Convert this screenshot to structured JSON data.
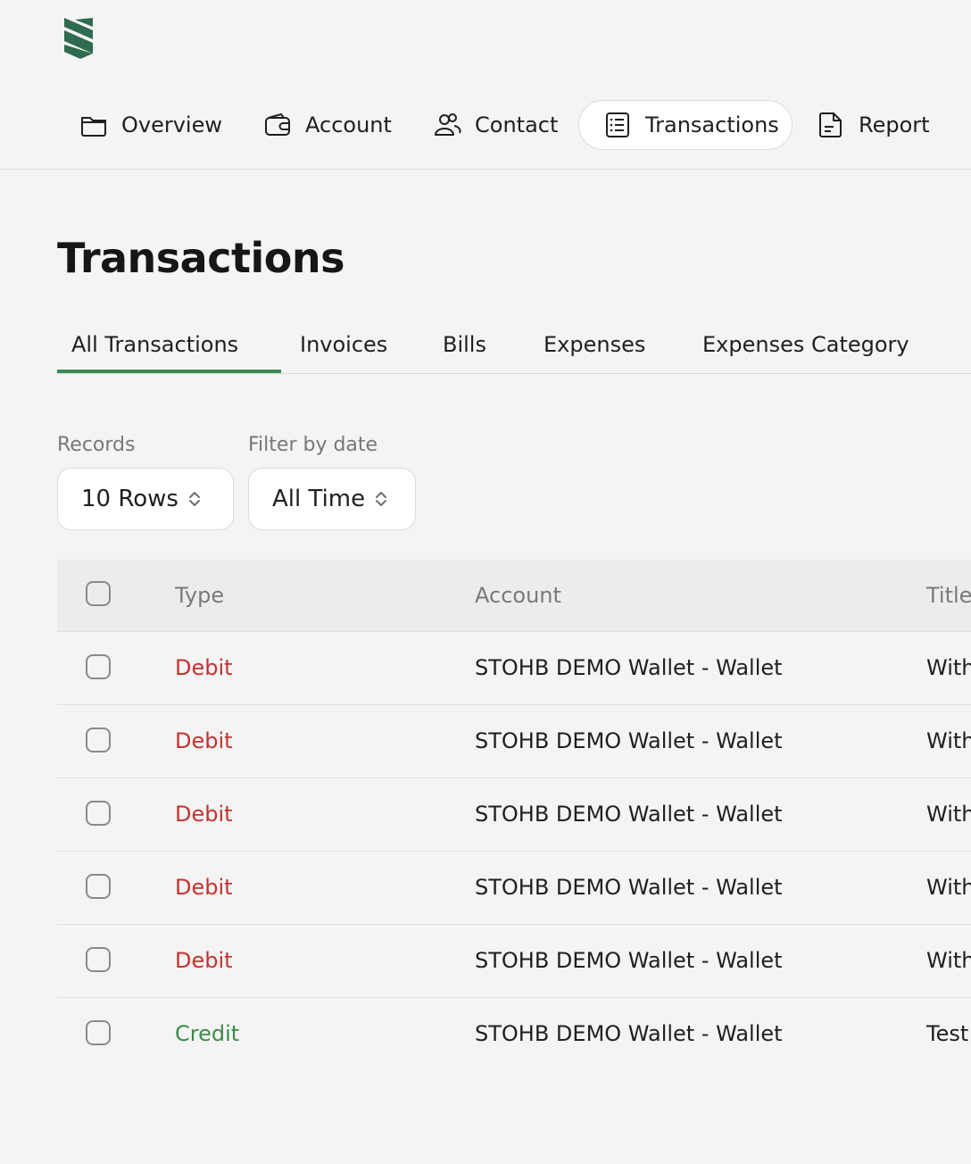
{
  "brand": {
    "color": "#2f6b4f"
  },
  "nav": {
    "items": [
      {
        "label": "Overview",
        "icon": "folder-icon"
      },
      {
        "label": "Account",
        "icon": "wallet-icon"
      },
      {
        "label": "Contact",
        "icon": "users-icon"
      },
      {
        "label": "Transactions",
        "icon": "receipt-icon",
        "active": true
      },
      {
        "label": "Report",
        "icon": "document-icon"
      }
    ]
  },
  "page": {
    "title": "Transactions"
  },
  "subtabs": [
    {
      "label": "All Transactions",
      "active": true
    },
    {
      "label": "Invoices"
    },
    {
      "label": "Bills"
    },
    {
      "label": "Expenses"
    },
    {
      "label": "Expenses Category"
    }
  ],
  "filters": {
    "records_label": "Records",
    "records_value": "10 Rows",
    "date_label": "Filter by date",
    "date_value": "All Time"
  },
  "table": {
    "headers": {
      "type": "Type",
      "account": "Account",
      "title": "Title"
    },
    "rows": [
      {
        "type": "Debit",
        "account": "STOHB DEMO Wallet - Wallet",
        "title": "With"
      },
      {
        "type": "Debit",
        "account": "STOHB DEMO Wallet - Wallet",
        "title": "With"
      },
      {
        "type": "Debit",
        "account": "STOHB DEMO Wallet - Wallet",
        "title": "With"
      },
      {
        "type": "Debit",
        "account": "STOHB DEMO Wallet - Wallet",
        "title": "With"
      },
      {
        "type": "Debit",
        "account": "STOHB DEMO Wallet - Wallet",
        "title": "With"
      },
      {
        "type": "Credit",
        "account": "STOHB DEMO Wallet - Wallet",
        "title": "Test"
      }
    ]
  },
  "colors": {
    "accent": "#3d8b57",
    "debit": "#c7322f",
    "credit": "#3f8a4a"
  }
}
